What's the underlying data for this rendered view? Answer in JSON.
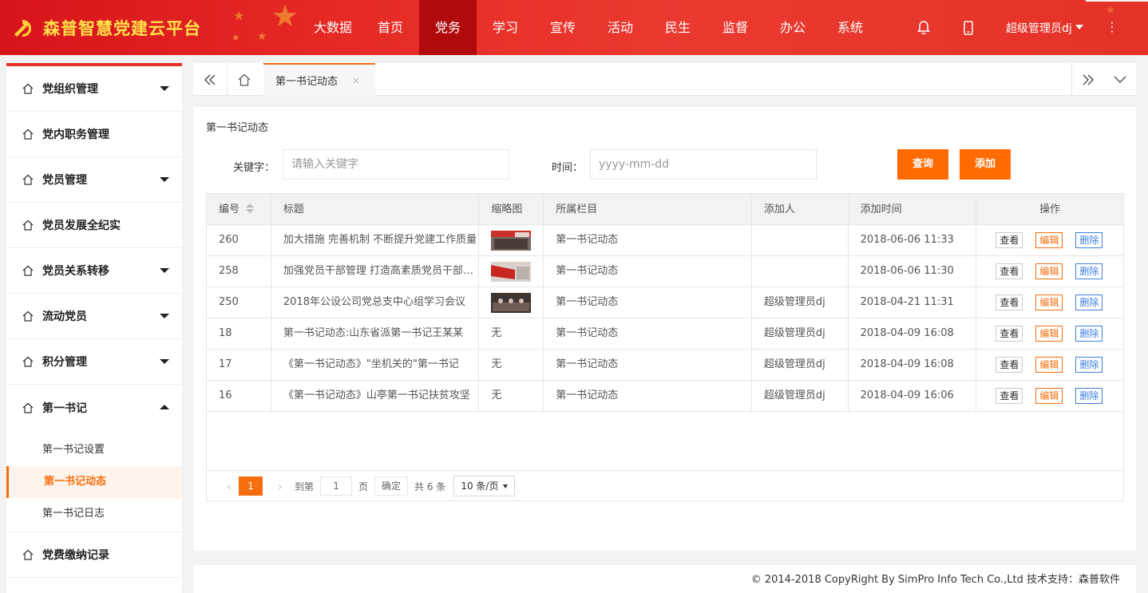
{
  "header": {
    "brand": "森普智慧党建云平台",
    "nav": [
      "大数据",
      "首页",
      "党务",
      "学习",
      "宣传",
      "活动",
      "民生",
      "监督",
      "办公",
      "系统"
    ],
    "active_nav": "党务",
    "user": "超级管理员dj",
    "more": "⋮"
  },
  "sidebar": {
    "items": [
      {
        "label": "党组织管理",
        "arrow": "down"
      },
      {
        "label": "党内职务管理",
        "arrow": ""
      },
      {
        "label": "党员管理",
        "arrow": "down"
      },
      {
        "label": "党员发展全纪实",
        "arrow": ""
      },
      {
        "label": "党员关系转移",
        "arrow": "down"
      },
      {
        "label": "流动党员",
        "arrow": "down"
      },
      {
        "label": "积分管理",
        "arrow": "down"
      },
      {
        "label": "第一书记",
        "arrow": "up"
      }
    ],
    "sub_items": [
      "第一书记设置",
      "第一书记动态",
      "第一书记日志"
    ],
    "active_sub": "第一书记动态",
    "after_items": [
      {
        "label": "党费缴纳记录",
        "arrow": ""
      }
    ]
  },
  "tabs": {
    "active_label": "第一书记动态",
    "close": "×"
  },
  "page": {
    "crumb": "第一书记动态",
    "keyword_label": "关键字：",
    "keyword_placeholder": "请输入关键字",
    "time_label": "时间：",
    "time_placeholder": "yyyy-mm-dd",
    "search_button": "查询",
    "add_button": "添加"
  },
  "table": {
    "headers": [
      "编号",
      "标题",
      "缩略图",
      "所属栏目",
      "添加人",
      "添加时间",
      "操作"
    ],
    "rows": [
      {
        "id": "260",
        "title": "加大措施 完善机制 不断提升党建工作质量",
        "thumb": "img1",
        "column": "第一书记动态",
        "adder": "",
        "time": "2018-06-06 11:33"
      },
      {
        "id": "258",
        "title": "加强党员干部管理 打造高素质党员干部队伍",
        "thumb": "img2",
        "column": "第一书记动态",
        "adder": "",
        "time": "2018-06-06 11:30"
      },
      {
        "id": "250",
        "title": "2018年公设公司党总支中心组学习会议",
        "thumb": "img3",
        "column": "第一书记动态",
        "adder": "超级管理员dj",
        "time": "2018-04-21 11:31"
      },
      {
        "id": "18",
        "title": "第一书记动态:山东省派第一书记王某某",
        "thumb": "无",
        "column": "第一书记动态",
        "adder": "超级管理员dj",
        "time": "2018-04-09 16:08"
      },
      {
        "id": "17",
        "title": "《第一书记动态》\"坐机关的\"第一书记",
        "thumb": "无",
        "column": "第一书记动态",
        "adder": "超级管理员dj",
        "time": "2018-04-09 16:08"
      },
      {
        "id": "16",
        "title": "《第一书记动态》山亭第一书记扶贫攻坚",
        "thumb": "无",
        "column": "第一书记动态",
        "adder": "超级管理员dj",
        "time": "2018-04-09 16:06"
      }
    ],
    "ops": {
      "view": "查看",
      "edit": "编辑",
      "delete": "删除"
    }
  },
  "pager": {
    "current": "1",
    "goto_label": "到第",
    "goto_value": "1",
    "page_unit": "页",
    "confirm": "确定",
    "total": "共 6 条",
    "page_size": "10 条/页"
  },
  "footer": "© 2014-2018 CopyRight By SimPro Info Tech Co.,Ltd 技术支持：森普软件",
  "colors": {
    "header_red": "#e62a25",
    "nav_active": "#b00a0d",
    "accent_orange": "#ff6b00",
    "brand_yellow": "#ffe14a",
    "delete_blue": "#3f7fdf"
  }
}
